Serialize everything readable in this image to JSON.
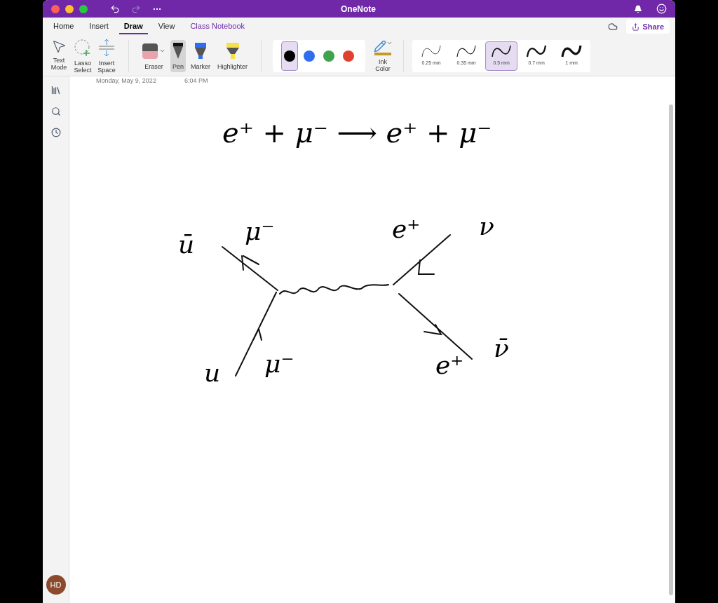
{
  "window": {
    "title": "OneNote"
  },
  "tabs": [
    {
      "label": "Home",
      "selected": false,
      "kind": "standard"
    },
    {
      "label": "Insert",
      "selected": false,
      "kind": "standard"
    },
    {
      "label": "Draw",
      "selected": true,
      "kind": "standard"
    },
    {
      "label": "View",
      "selected": false,
      "kind": "standard"
    },
    {
      "label": "Class Notebook",
      "selected": false,
      "kind": "addin"
    }
  ],
  "share": "Share",
  "tools": [
    {
      "label": "Text Mode",
      "kind": "text"
    },
    {
      "label": "Lasso Select",
      "kind": "lasso"
    },
    {
      "label": "Insert Space",
      "kind": "space"
    }
  ],
  "pens": [
    {
      "label": "Eraser",
      "kind": "eraser",
      "selected": false
    },
    {
      "label": "Pen",
      "kind": "pen",
      "selected": true
    },
    {
      "label": "Marker",
      "kind": "marker",
      "selected": false
    },
    {
      "label": "Highlighter",
      "kind": "highlighter",
      "selected": false
    }
  ],
  "colors": [
    {
      "color": "#000000",
      "selected": true
    },
    {
      "color": "#2f6fef",
      "selected": false
    },
    {
      "color": "#3fa34d",
      "selected": false
    },
    {
      "color": "#e0412f",
      "selected": false
    }
  ],
  "ink_color": "Ink Color",
  "thickness": [
    {
      "label": "0.25 mm",
      "selected": false
    },
    {
      "label": "0.35 mm",
      "selected": false
    },
    {
      "label": "0.5 mm",
      "selected": true
    },
    {
      "label": "0.7 mm",
      "selected": false
    },
    {
      "label": "1 mm",
      "selected": false
    }
  ],
  "page": {
    "date": "Monday, May 9, 2022",
    "time": "6:04 PM"
  },
  "ink": {
    "equation": "e⁺  +  μ⁻  ⟶  e⁺  +  μ⁻",
    "labels": [
      "ū",
      "μ⁻",
      "e⁺",
      "ν",
      "u",
      "μ⁻",
      "e⁺",
      "ν̄"
    ]
  },
  "user": {
    "initials": "HD"
  }
}
